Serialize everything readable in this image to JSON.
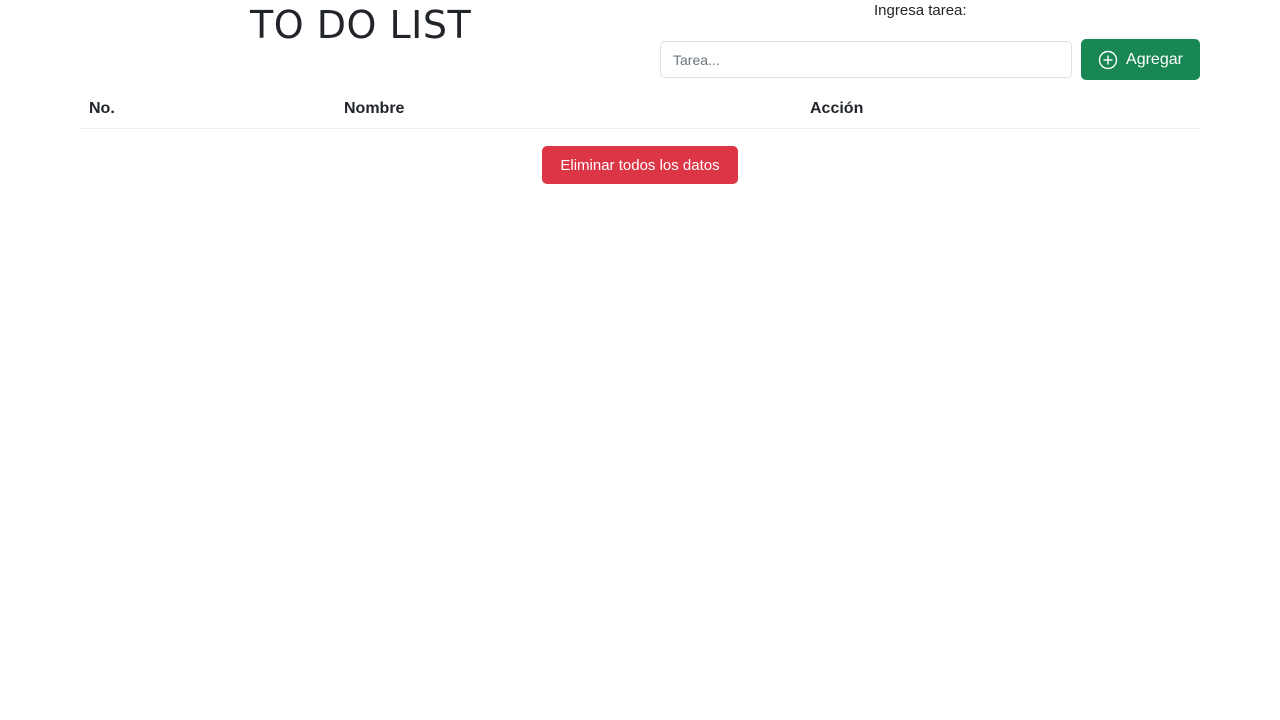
{
  "header": {
    "title": "TO DO LIST"
  },
  "form": {
    "label": "Ingresa tarea:",
    "input_placeholder": "Tarea...",
    "input_value": "",
    "add_label": "Agregar",
    "add_icon": "plus-circle-icon"
  },
  "table": {
    "columns": [
      "No.",
      "Nombre",
      "Acción"
    ],
    "rows": []
  },
  "actions": {
    "delete_all_label": "Eliminar todos los datos"
  },
  "colors": {
    "success": "#198754",
    "danger": "#dc3545",
    "text": "#212529"
  }
}
